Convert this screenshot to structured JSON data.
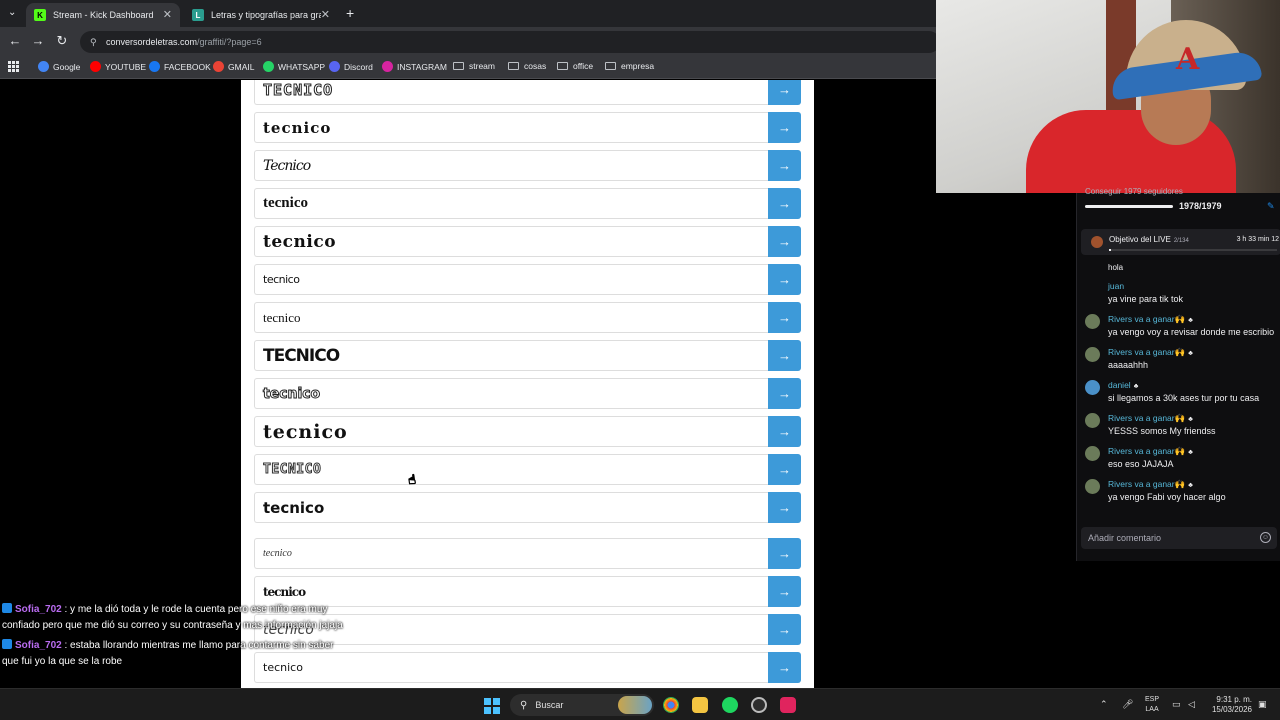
{
  "browser": {
    "tabs": [
      {
        "title": "Stream - Kick Dashboard",
        "favicon": "K",
        "active": true
      },
      {
        "title": "Letras y tipografías para graffiti",
        "favicon": "L",
        "active": false
      }
    ],
    "new_tab": "+",
    "url_host": "conversordeletras.com",
    "url_path": "/graffiti/?page=6",
    "bookmarks": [
      {
        "label": "Google",
        "icon": "google-icon",
        "color": "#4285f4"
      },
      {
        "label": "YOUTUBE",
        "icon": "youtube-icon",
        "color": "#ff0000"
      },
      {
        "label": "FACEBOOK",
        "icon": "facebook-icon",
        "color": "#1877f2"
      },
      {
        "label": "GMAIL",
        "icon": "gmail-icon",
        "color": "#ea4335"
      },
      {
        "label": "WHATSAPP",
        "icon": "whatsapp-icon",
        "color": "#25d366"
      },
      {
        "label": "Discord",
        "icon": "discord-icon",
        "color": "#5865f2"
      },
      {
        "label": "INSTAGRAM",
        "icon": "instagram-icon",
        "color": "#d6249f"
      },
      {
        "label": "stream",
        "icon": "folder-icon"
      },
      {
        "label": "cosas",
        "icon": "folder-icon"
      },
      {
        "label": "office",
        "icon": "folder-icon"
      },
      {
        "label": "empresa",
        "icon": "folder-icon"
      }
    ]
  },
  "page": {
    "word": "tecnico",
    "arrow": "→",
    "rows": [
      {
        "text": "TECNICO",
        "style": "s0"
      },
      {
        "text": "tecnico",
        "style": "s1"
      },
      {
        "text": "Tecnico",
        "style": "s2"
      },
      {
        "text": "tecnico",
        "style": "s3"
      },
      {
        "text": "tecnico",
        "style": "s4"
      },
      {
        "text": "tecnico",
        "style": "s5"
      },
      {
        "text": "tecnico",
        "style": "s6"
      },
      {
        "text": "TECNICO",
        "style": "s7"
      },
      {
        "text": "tecnico",
        "style": "s8"
      },
      {
        "text": "tecnico",
        "style": "s9"
      },
      {
        "text": "TECNICO",
        "style": "s10"
      },
      {
        "text": "tecnico",
        "style": "s11"
      },
      {
        "text": "tecnico",
        "style": "s12"
      },
      {
        "text": "tecnico",
        "style": "s13"
      },
      {
        "text": "tecnico",
        "style": "s14"
      },
      {
        "text": "tecnico",
        "style": "s15"
      }
    ]
  },
  "overlay_chat": [
    {
      "user": "Sofia_702",
      "text": ": y me la dió toda y le rode la cuenta pero ese niño era muy confiado pero que me dió su correo y su contraseña y mas información jajaja"
    },
    {
      "user": "Sofia_702",
      "text": ": estaba llorando mientras me llamo para contarme sin saber que fui yo la que se la robe"
    }
  ],
  "live_panel": {
    "goal_label": "Conseguir 1979 seguidores",
    "goal_progress": "1978/1979",
    "goal_fraction": 0.9995,
    "objective_title": "Objetivo del LIVE",
    "objective_count": "2/134",
    "objective_time": "3 h 33 min 12",
    "cut_message": "hola",
    "messages": [
      {
        "user": "juan",
        "text": "ya vine para tik tok",
        "avatar": false
      },
      {
        "user": "Rivers va a ganar🙌",
        "text": "ya vengo voy a revisar donde me escribio",
        "avatar": true
      },
      {
        "user": "Rivers va a ganar🙌",
        "text": "aaaaahhh",
        "avatar": true
      },
      {
        "user": "daniel",
        "text": "si llegamos a 30k ases tur por tu casa",
        "avatar": true,
        "blue": true
      },
      {
        "user": "Rivers va a ganar🙌",
        "text": "YESSS somos My friendss",
        "avatar": true
      },
      {
        "user": "Rivers va a ganar🙌",
        "text": "eso eso JAJAJA",
        "avatar": true
      },
      {
        "user": "Rivers va a ganar🙌",
        "text": "ya vengo Fabi voy hacer algo",
        "avatar": true
      }
    ],
    "comment_placeholder": "Añadir comentario"
  },
  "taskbar": {
    "search": "Buscar",
    "lang_1": "ESP",
    "lang_2": "LAA",
    "time": "9:31 p. m.",
    "date": "15/03/2026"
  }
}
